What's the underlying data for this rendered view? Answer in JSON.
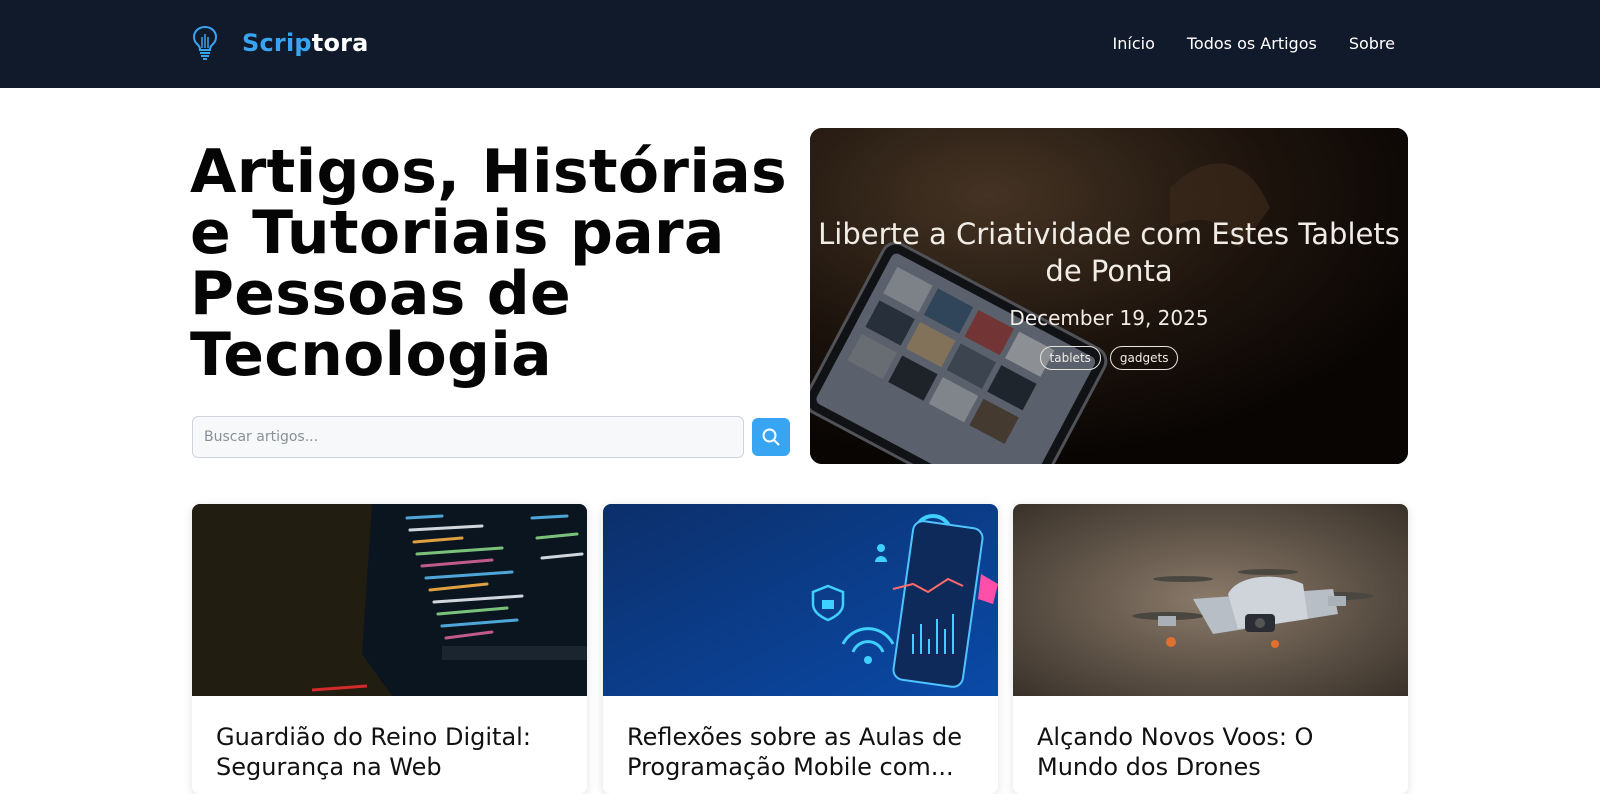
{
  "header": {
    "logo": {
      "icon": "lightbulb-icon",
      "name_accent": "Scrip",
      "name_rest": "tora"
    },
    "nav": [
      {
        "label": "Início"
      },
      {
        "label": "Todos os Artigos"
      },
      {
        "label": "Sobre"
      }
    ]
  },
  "hero": {
    "title": "Artigos, Histórias e Tutoriais para Pessoas de Tecnologia",
    "search": {
      "placeholder": "Buscar artigos...",
      "button_icon": "search-icon"
    }
  },
  "featured": {
    "title": "Liberte a Criatividade com Estes Tablets de Ponta",
    "date": "December 19, 2025",
    "tags": [
      "tablets",
      "gadgets"
    ]
  },
  "articles": [
    {
      "title": "Guardião do Reino Digital: Segurança na Web"
    },
    {
      "title": "Reflexões sobre as Aulas de Programação Mobile com..."
    },
    {
      "title": "Alçando Novos Voos: O Mundo dos Drones"
    }
  ],
  "colors": {
    "header_bg": "#111a2b",
    "accent": "#38a5f3"
  }
}
